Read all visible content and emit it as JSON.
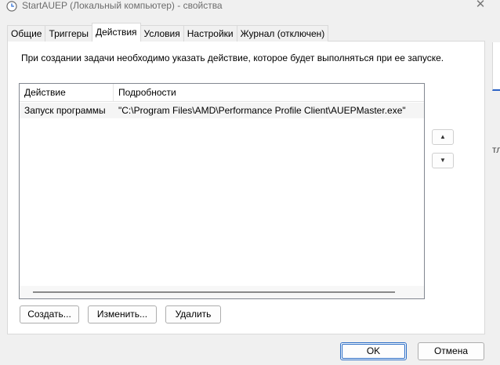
{
  "window": {
    "title": "StartAUEP (Локальный компьютер) - свойства",
    "close_glyph": "✕"
  },
  "tabs": [
    {
      "label": "Общие"
    },
    {
      "label": "Триггеры"
    },
    {
      "label": "Действия",
      "active": true
    },
    {
      "label": "Условия"
    },
    {
      "label": "Настройки"
    },
    {
      "label": "Журнал (отключен)"
    }
  ],
  "main": {
    "description": "При создании задачи необходимо указать действие, которое будет выполняться при ее запуске.",
    "columns": [
      "Действие",
      "Подробности"
    ],
    "rows": [
      {
        "action": "Запуск программы",
        "details": "\"C:\\Program Files\\AMD\\Performance Profile Client\\AUEPMaster.exe\""
      }
    ],
    "buttons": {
      "create": "Создать...",
      "edit": "Изменить...",
      "delete": "Удалить"
    },
    "move_up_glyph": "▲",
    "move_down_glyph": "▼"
  },
  "footer": {
    "ok": "OK",
    "cancel": "Отмена"
  },
  "background": {
    "partial_text": "тл"
  },
  "colors": {
    "accent": "#2b6dc6",
    "dialog_bg": "#f0f0f0",
    "panel_bg": "#ffffff"
  }
}
